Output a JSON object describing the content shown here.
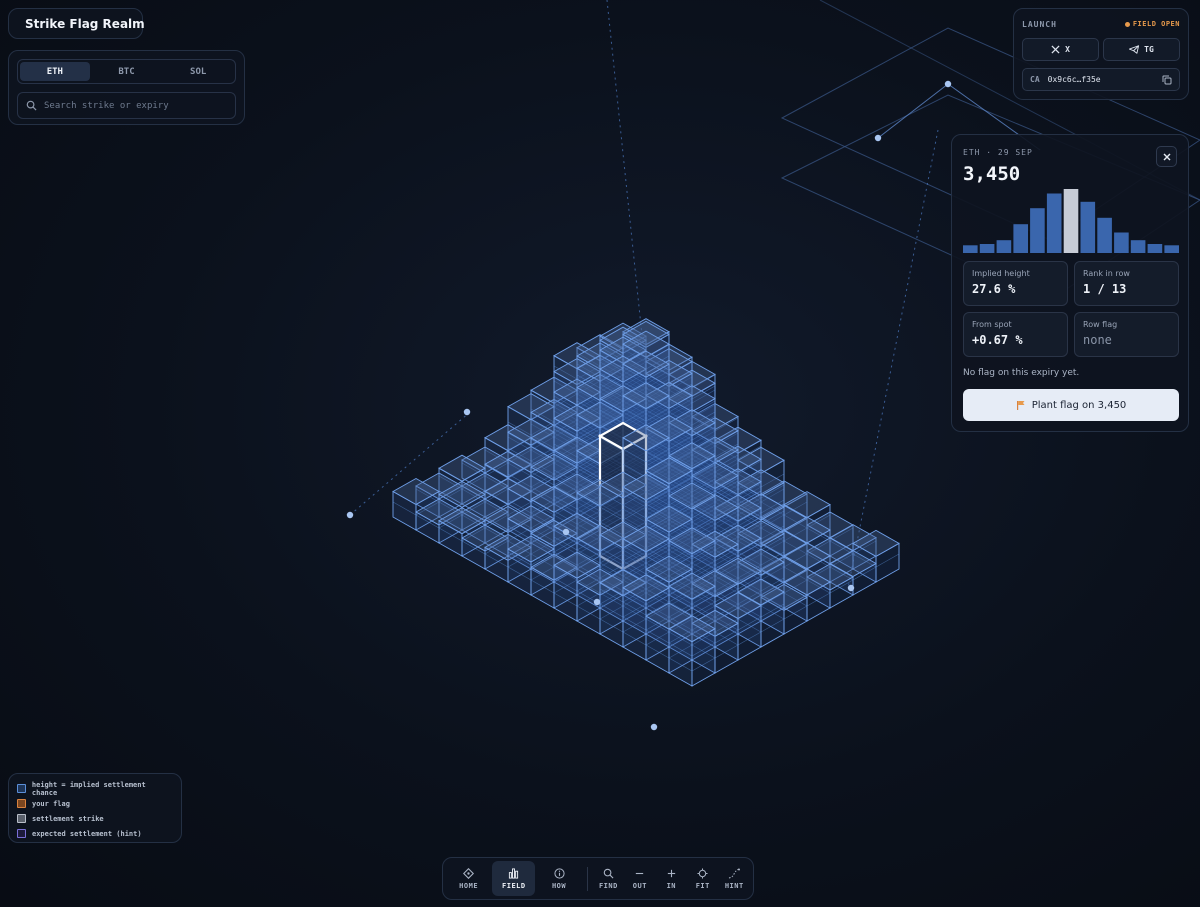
{
  "app": {
    "title": "Strike Flag Realm",
    "logo_icon": "cube-logo-icon"
  },
  "assets": {
    "tabs": [
      {
        "label": "ETH",
        "active": true
      },
      {
        "label": "BTC",
        "active": false
      },
      {
        "label": "SOL",
        "active": false
      }
    ],
    "search_placeholder": "Search strike or expiry"
  },
  "launch": {
    "title": "LAUNCH",
    "status": "FIELD OPEN",
    "x_label": "X",
    "tg_label": "TG",
    "ca_label": "CA",
    "ca_value": "0x9c6c…f35e"
  },
  "detail": {
    "meta": "ETH · 29 SEP",
    "strike": "3,450",
    "histogram": [
      0.12,
      0.14,
      0.2,
      0.45,
      0.7,
      0.93,
      1.0,
      0.8,
      0.55,
      0.32,
      0.2,
      0.14,
      0.12
    ],
    "selected_index": 6,
    "stats": {
      "implied_height_label": "Implied height",
      "implied_height": "27.6 %",
      "rank_label": "Rank in row",
      "rank": "1 / 13",
      "from_spot_label": "From spot",
      "from_spot": "+0.67 %",
      "row_flag_label": "Row flag",
      "row_flag": "none"
    },
    "note": "No flag on this expiry yet.",
    "plant_label": "Plant flag on 3,450"
  },
  "legend": {
    "items": [
      {
        "label": "height = implied settlement chance",
        "color": "#5b8fd9"
      },
      {
        "label": "your flag",
        "color": "#d9823f"
      },
      {
        "label": "settlement strike",
        "color": "#b9bfc9"
      },
      {
        "label": "expected settlement (hint)",
        "color": "#7a6fd6"
      }
    ]
  },
  "toolbar": {
    "home": "HOME",
    "field": "FIELD",
    "how": "HOW",
    "find": "FIND",
    "out": "OUT",
    "in": "IN",
    "fit": "FIT",
    "hint": "HINT"
  },
  "colors": {
    "accent": "#6f9fe8",
    "flag": "#e79a4c",
    "selected": "#ffffff"
  }
}
